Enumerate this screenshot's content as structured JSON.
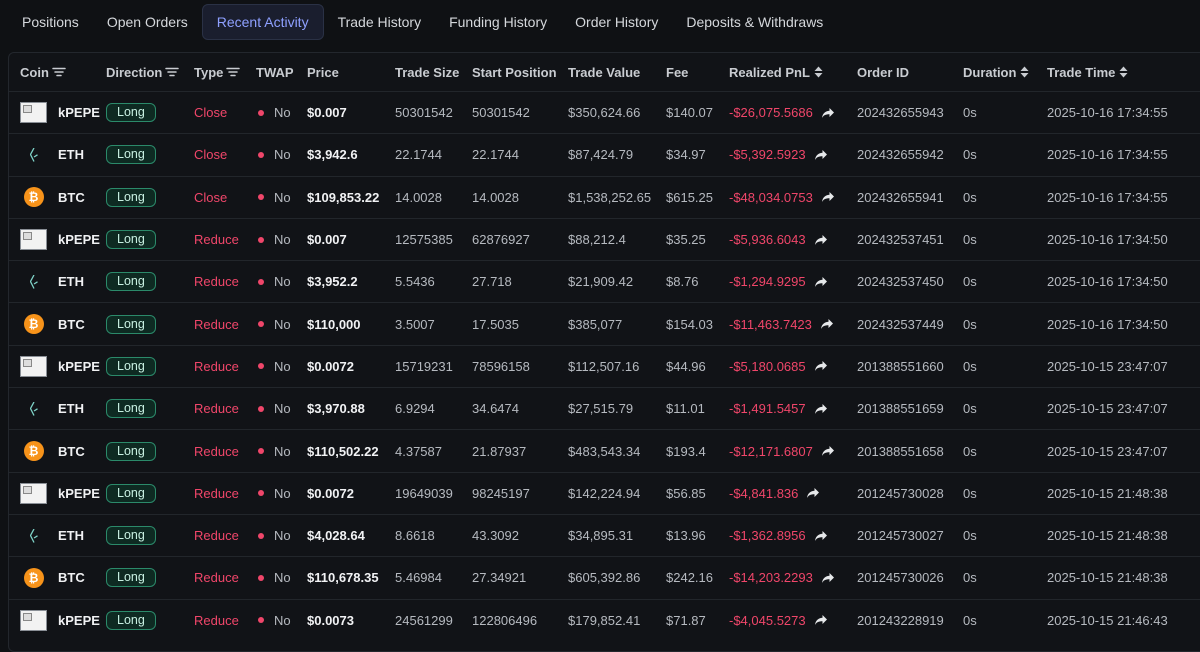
{
  "tabs": [
    {
      "label": "Positions",
      "active": false
    },
    {
      "label": "Open Orders",
      "active": false
    },
    {
      "label": "Recent Activity",
      "active": true
    },
    {
      "label": "Trade History",
      "active": false
    },
    {
      "label": "Funding History",
      "active": false
    },
    {
      "label": "Order History",
      "active": false
    },
    {
      "label": "Deposits & Withdraws",
      "active": false
    }
  ],
  "headers": {
    "coin": "Coin",
    "direction": "Direction",
    "type": "Type",
    "twap": "TWAP",
    "price": "Price",
    "trade_size": "Trade Size",
    "start_position": "Start Position",
    "trade_value": "Trade Value",
    "fee": "Fee",
    "realized_pnl": "Realized PnL",
    "order_id": "Order ID",
    "duration": "Duration",
    "trade_time": "Trade Time"
  },
  "colors": {
    "accent": "#8ea0ff",
    "negative": "#f0466a",
    "long_badge": "#2b8a6a",
    "btc": "#f7931a"
  },
  "rows": [
    {
      "coin": "kPEPE",
      "icon": "broken-image-icon",
      "direction": "Long",
      "type": "Close",
      "twap": "No",
      "price": "$0.007",
      "trade_size": "50301542",
      "start_position": "50301542",
      "trade_value": "$350,624.66",
      "fee": "$140.07",
      "pnl": "-$26,075.5686",
      "order_id": "202432655943",
      "duration": "0s",
      "time": "2025-10-16 17:34:55"
    },
    {
      "coin": "ETH",
      "icon": "eth-icon",
      "direction": "Long",
      "type": "Close",
      "twap": "No",
      "price": "$3,942.6",
      "trade_size": "22.1744",
      "start_position": "22.1744",
      "trade_value": "$87,424.79",
      "fee": "$34.97",
      "pnl": "-$5,392.5923",
      "order_id": "202432655942",
      "duration": "0s",
      "time": "2025-10-16 17:34:55"
    },
    {
      "coin": "BTC",
      "icon": "btc-icon",
      "direction": "Long",
      "type": "Close",
      "twap": "No",
      "price": "$109,853.22",
      "trade_size": "14.0028",
      "start_position": "14.0028",
      "trade_value": "$1,538,252.65",
      "fee": "$615.25",
      "pnl": "-$48,034.0753",
      "order_id": "202432655941",
      "duration": "0s",
      "time": "2025-10-16 17:34:55"
    },
    {
      "coin": "kPEPE",
      "icon": "broken-image-icon",
      "direction": "Long",
      "type": "Reduce",
      "twap": "No",
      "price": "$0.007",
      "trade_size": "12575385",
      "start_position": "62876927",
      "trade_value": "$88,212.4",
      "fee": "$35.25",
      "pnl": "-$5,936.6043",
      "order_id": "202432537451",
      "duration": "0s",
      "time": "2025-10-16 17:34:50"
    },
    {
      "coin": "ETH",
      "icon": "eth-icon",
      "direction": "Long",
      "type": "Reduce",
      "twap": "No",
      "price": "$3,952.2",
      "trade_size": "5.5436",
      "start_position": "27.718",
      "trade_value": "$21,909.42",
      "fee": "$8.76",
      "pnl": "-$1,294.9295",
      "order_id": "202432537450",
      "duration": "0s",
      "time": "2025-10-16 17:34:50"
    },
    {
      "coin": "BTC",
      "icon": "btc-icon",
      "direction": "Long",
      "type": "Reduce",
      "twap": "No",
      "price": "$110,000",
      "trade_size": "3.5007",
      "start_position": "17.5035",
      "trade_value": "$385,077",
      "fee": "$154.03",
      "pnl": "-$11,463.7423",
      "order_id": "202432537449",
      "duration": "0s",
      "time": "2025-10-16 17:34:50"
    },
    {
      "coin": "kPEPE",
      "icon": "broken-image-icon",
      "direction": "Long",
      "type": "Reduce",
      "twap": "No",
      "price": "$0.0072",
      "trade_size": "15719231",
      "start_position": "78596158",
      "trade_value": "$112,507.16",
      "fee": "$44.96",
      "pnl": "-$5,180.0685",
      "order_id": "201388551660",
      "duration": "0s",
      "time": "2025-10-15 23:47:07"
    },
    {
      "coin": "ETH",
      "icon": "eth-icon",
      "direction": "Long",
      "type": "Reduce",
      "twap": "No",
      "price": "$3,970.88",
      "trade_size": "6.9294",
      "start_position": "34.6474",
      "trade_value": "$27,515.79",
      "fee": "$11.01",
      "pnl": "-$1,491.5457",
      "order_id": "201388551659",
      "duration": "0s",
      "time": "2025-10-15 23:47:07"
    },
    {
      "coin": "BTC",
      "icon": "btc-icon",
      "direction": "Long",
      "type": "Reduce",
      "twap": "No",
      "price": "$110,502.22",
      "trade_size": "4.37587",
      "start_position": "21.87937",
      "trade_value": "$483,543.34",
      "fee": "$193.4",
      "pnl": "-$12,171.6807",
      "order_id": "201388551658",
      "duration": "0s",
      "time": "2025-10-15 23:47:07"
    },
    {
      "coin": "kPEPE",
      "icon": "broken-image-icon",
      "direction": "Long",
      "type": "Reduce",
      "twap": "No",
      "price": "$0.0072",
      "trade_size": "19649039",
      "start_position": "98245197",
      "trade_value": "$142,224.94",
      "fee": "$56.85",
      "pnl": "-$4,841.836",
      "order_id": "201245730028",
      "duration": "0s",
      "time": "2025-10-15 21:48:38"
    },
    {
      "coin": "ETH",
      "icon": "eth-icon",
      "direction": "Long",
      "type": "Reduce",
      "twap": "No",
      "price": "$4,028.64",
      "trade_size": "8.6618",
      "start_position": "43.3092",
      "trade_value": "$34,895.31",
      "fee": "$13.96",
      "pnl": "-$1,362.8956",
      "order_id": "201245730027",
      "duration": "0s",
      "time": "2025-10-15 21:48:38"
    },
    {
      "coin": "BTC",
      "icon": "btc-icon",
      "direction": "Long",
      "type": "Reduce",
      "twap": "No",
      "price": "$110,678.35",
      "trade_size": "5.46984",
      "start_position": "27.34921",
      "trade_value": "$605,392.86",
      "fee": "$242.16",
      "pnl": "-$14,203.2293",
      "order_id": "201245730026",
      "duration": "0s",
      "time": "2025-10-15 21:48:38"
    },
    {
      "coin": "kPEPE",
      "icon": "broken-image-icon",
      "direction": "Long",
      "type": "Reduce",
      "twap": "No",
      "price": "$0.0073",
      "trade_size": "24561299",
      "start_position": "122806496",
      "trade_value": "$179,852.41",
      "fee": "$71.87",
      "pnl": "-$4,045.5273",
      "order_id": "201243228919",
      "duration": "0s",
      "time": "2025-10-15 21:46:43"
    }
  ]
}
